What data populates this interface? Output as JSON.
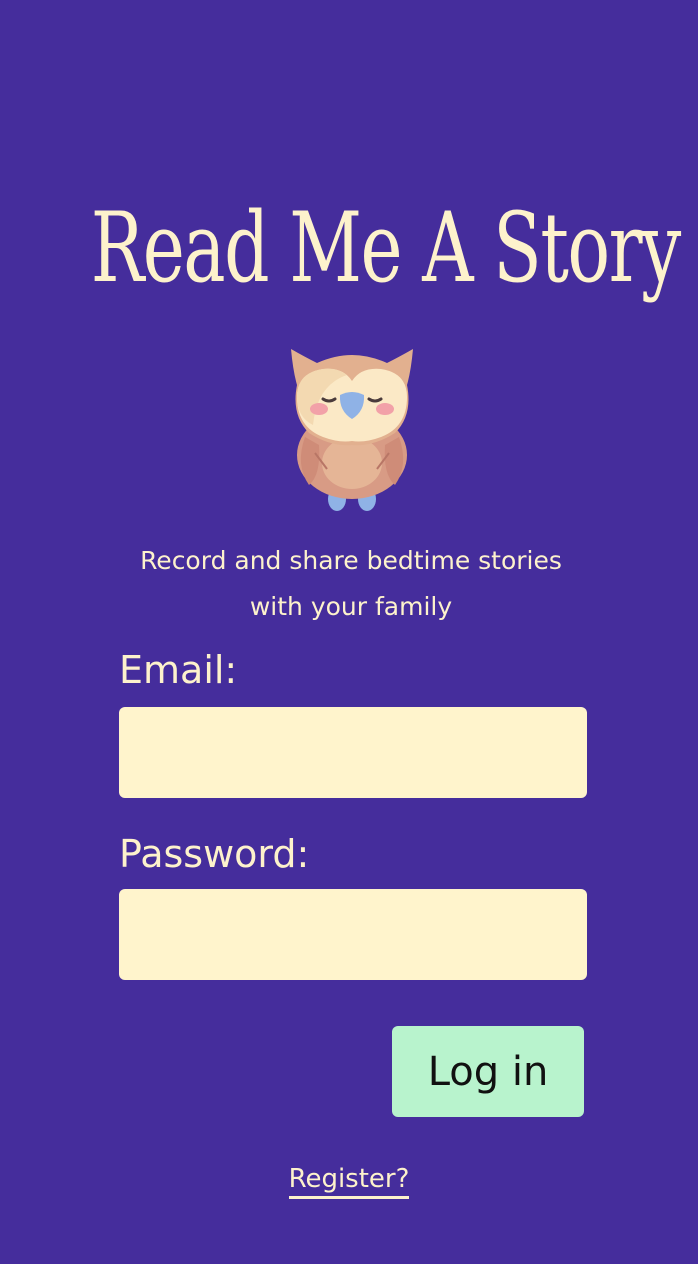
{
  "app": {
    "title": "Read Me A Story",
    "tagline_line1": "Record and share bedtime stories",
    "tagline_line2": "with your family",
    "mascot_icon": "owl-icon"
  },
  "form": {
    "email_label": "Email:",
    "email_value": "",
    "password_label": "Password:",
    "password_value": "",
    "login_label": "Log in",
    "register_label": "Register?"
  },
  "colors": {
    "background": "#452d9c",
    "text": "#fdf2cc",
    "input_background": "#fff4cc",
    "button_background": "#b8f3cd"
  }
}
